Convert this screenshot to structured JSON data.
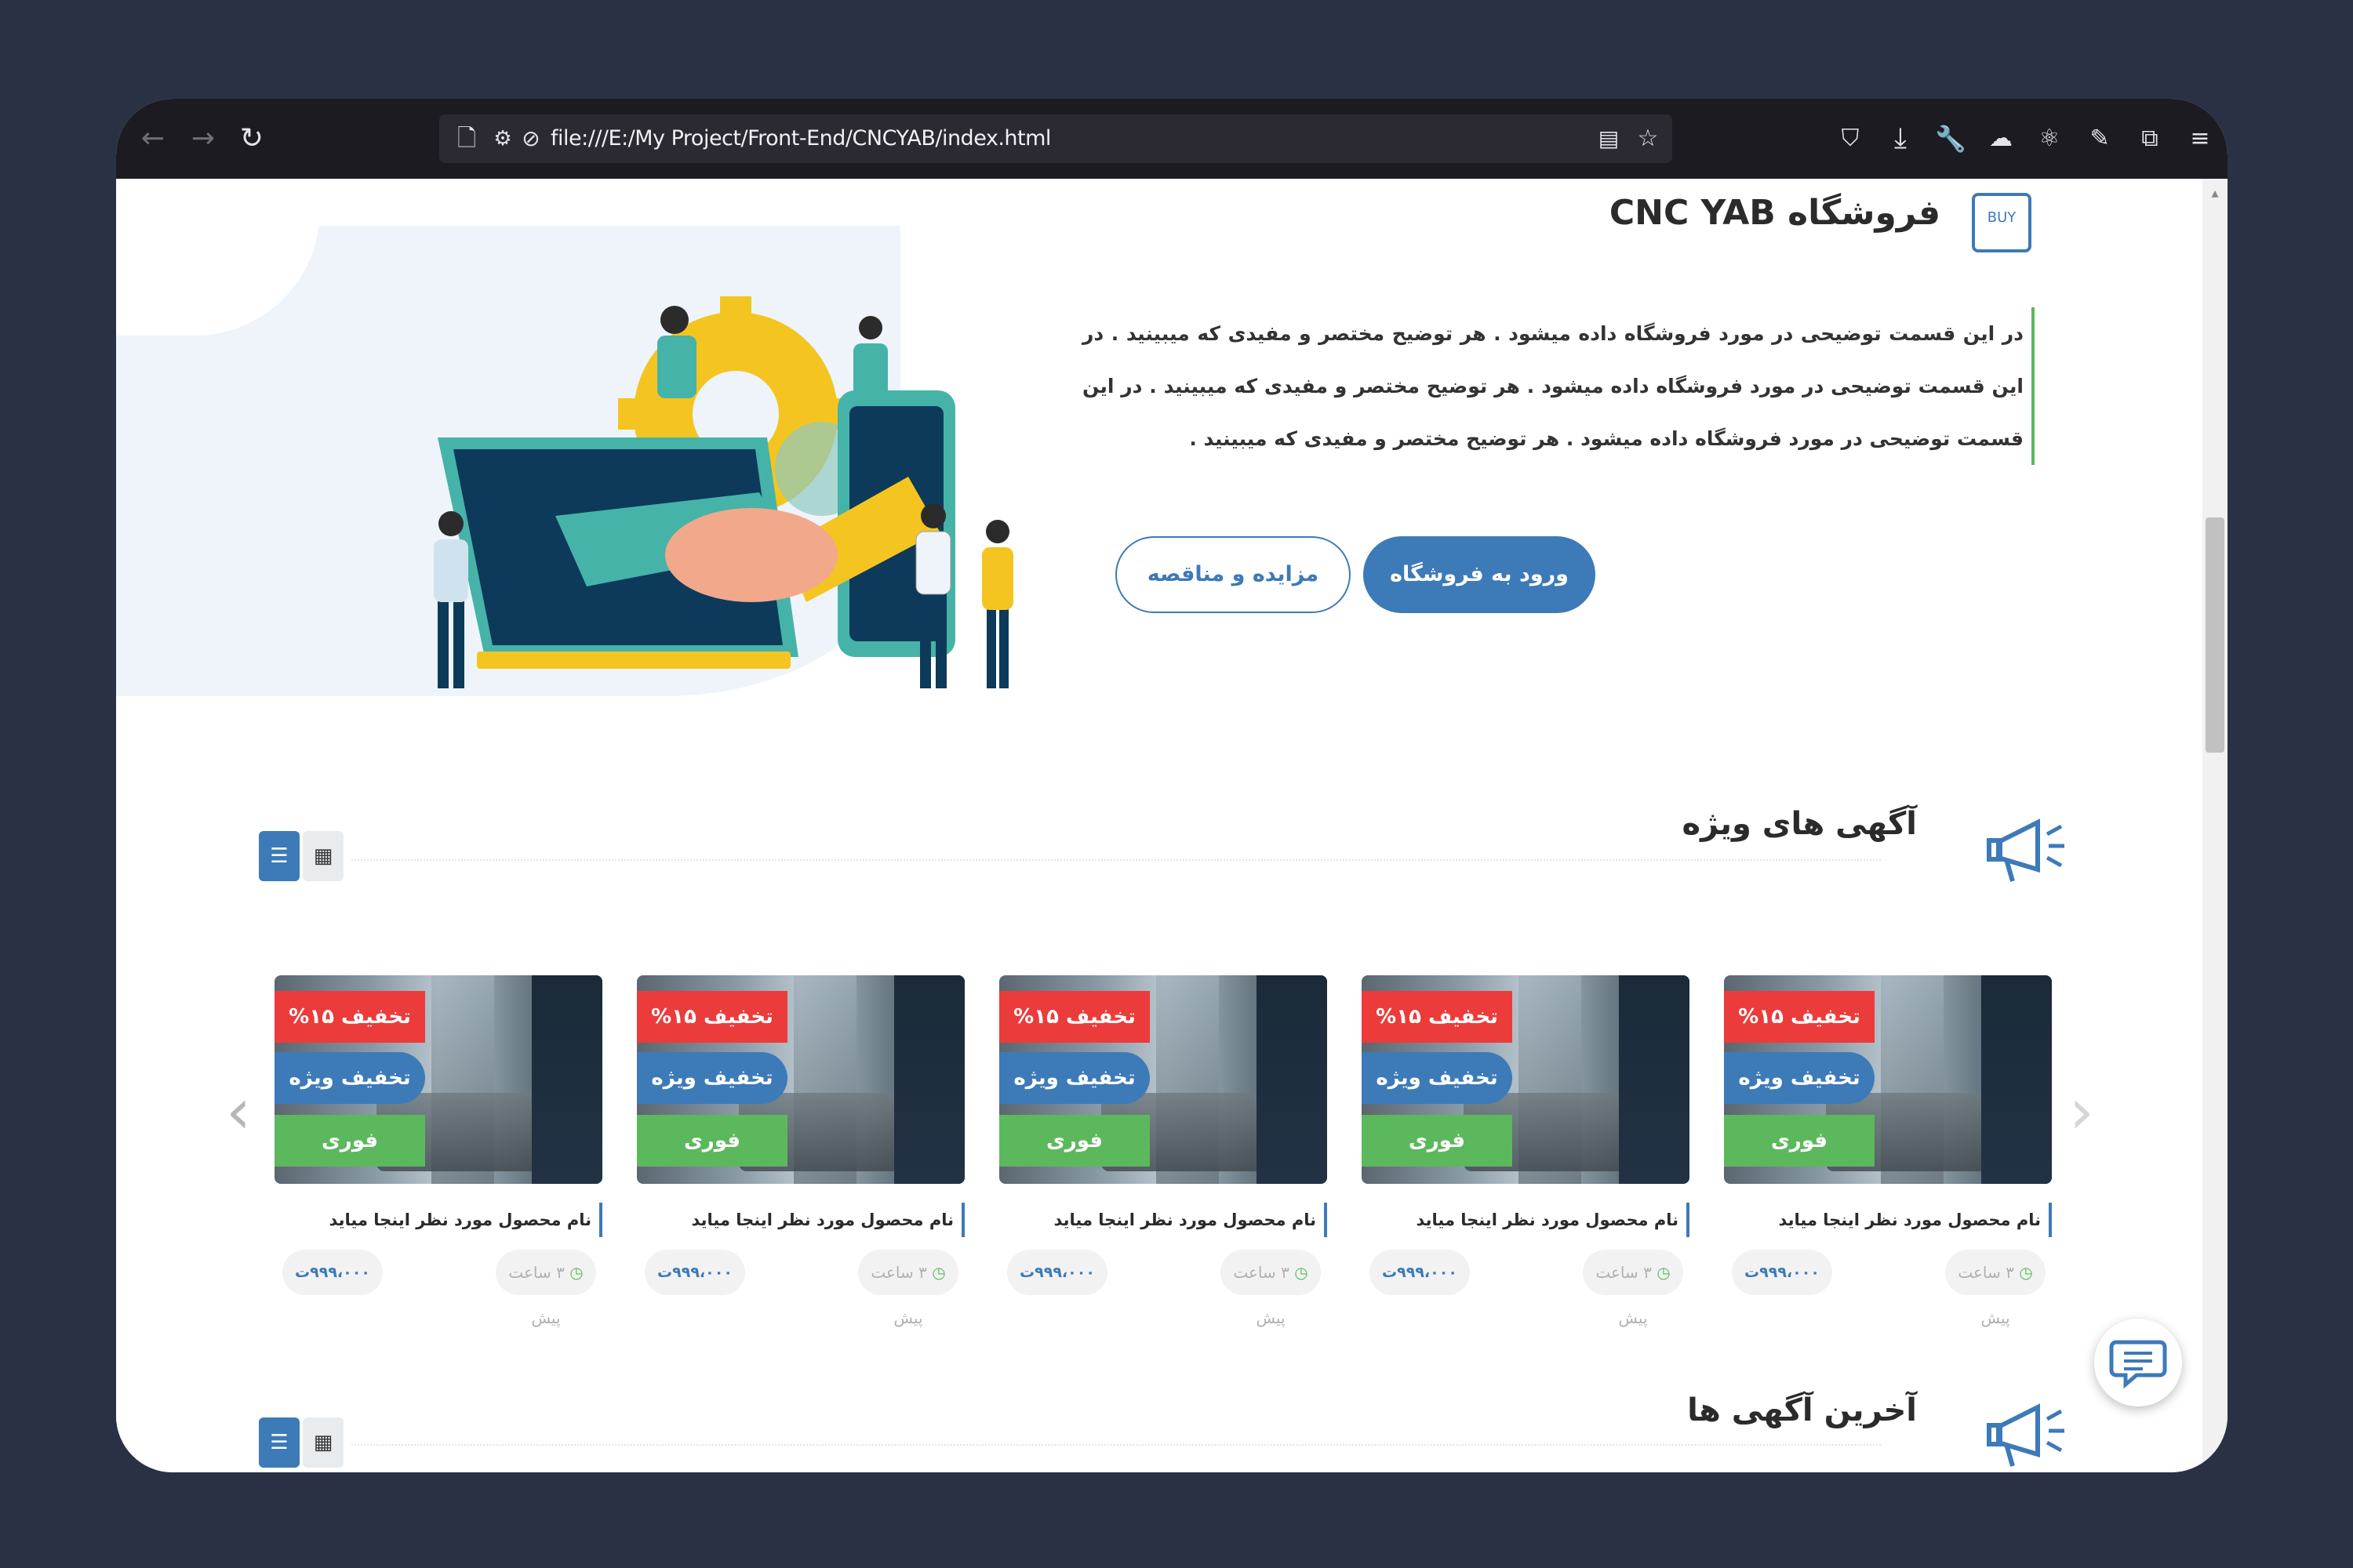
{
  "browser": {
    "url": "file:///E:/My Project/Front-End/CNCYAB/index.html"
  },
  "hero": {
    "title": "فروشگاه CNC YAB",
    "logo_text": "BUY",
    "description": "در این قسمت توضیحی در مورد فروشگاه داده میشود . هر توضیح مختصر و مفیدی که میبینید . در این قسمت توضیحی در مورد فروشگاه داده میشود . هر توضیح مختصر و مفیدی که میبینید . در این قسمت توضیحی در مورد فروشگاه داده میشود . هر توضیح مختصر و مفیدی که میبینید .",
    "primary_button": "ورود به فروشگاه",
    "secondary_button": "مزایده و مناقصه"
  },
  "featured": {
    "title": "آگهی های ویژه",
    "view_list_icon": "list-icon",
    "view_grid_icon": "grid-icon"
  },
  "latest": {
    "title": "آخرین آگهی ها"
  },
  "cards": [
    {
      "discount": "تخفیف ۱۵%",
      "special": "تخفیف ویژه",
      "urgent": "فوری",
      "name": "نام محصول مورد نظر اینجا میاید",
      "time": "۳ ساعت پیش",
      "price": "۹۹۹،۰۰۰ت"
    },
    {
      "discount": "تخفیف ۱۵%",
      "special": "تخفیف ویژه",
      "urgent": "فوری",
      "name": "نام محصول مورد نظر اینجا میاید",
      "time": "۳ ساعت پیش",
      "price": "۹۹۹،۰۰۰ت"
    },
    {
      "discount": "تخفیف ۱۵%",
      "special": "تخفیف ویژه",
      "urgent": "فوری",
      "name": "نام محصول مورد نظر اینجا میاید",
      "time": "۳ ساعت پیش",
      "price": "۹۹۹،۰۰۰ت"
    },
    {
      "discount": "تخفیف ۱۵%",
      "special": "تخفیف ویژه",
      "urgent": "فوری",
      "name": "نام محصول مورد نظر اینجا میاید",
      "time": "۳ ساعت پیش",
      "price": "۹۹۹،۰۰۰ت"
    },
    {
      "discount": "تخفیف ۱۵%",
      "special": "تخفیف ویژه",
      "urgent": "فوری",
      "name": "نام محصول مورد نظر اینجا میاید",
      "time": "۳ ساعت پیش",
      "price": "۹۹۹،۰۰۰ت"
    }
  ],
  "colors": {
    "brand_blue": "#3d7ab8",
    "red": "#ec3b3b",
    "green": "#5cb85c",
    "page_bg": "#2b3145"
  }
}
